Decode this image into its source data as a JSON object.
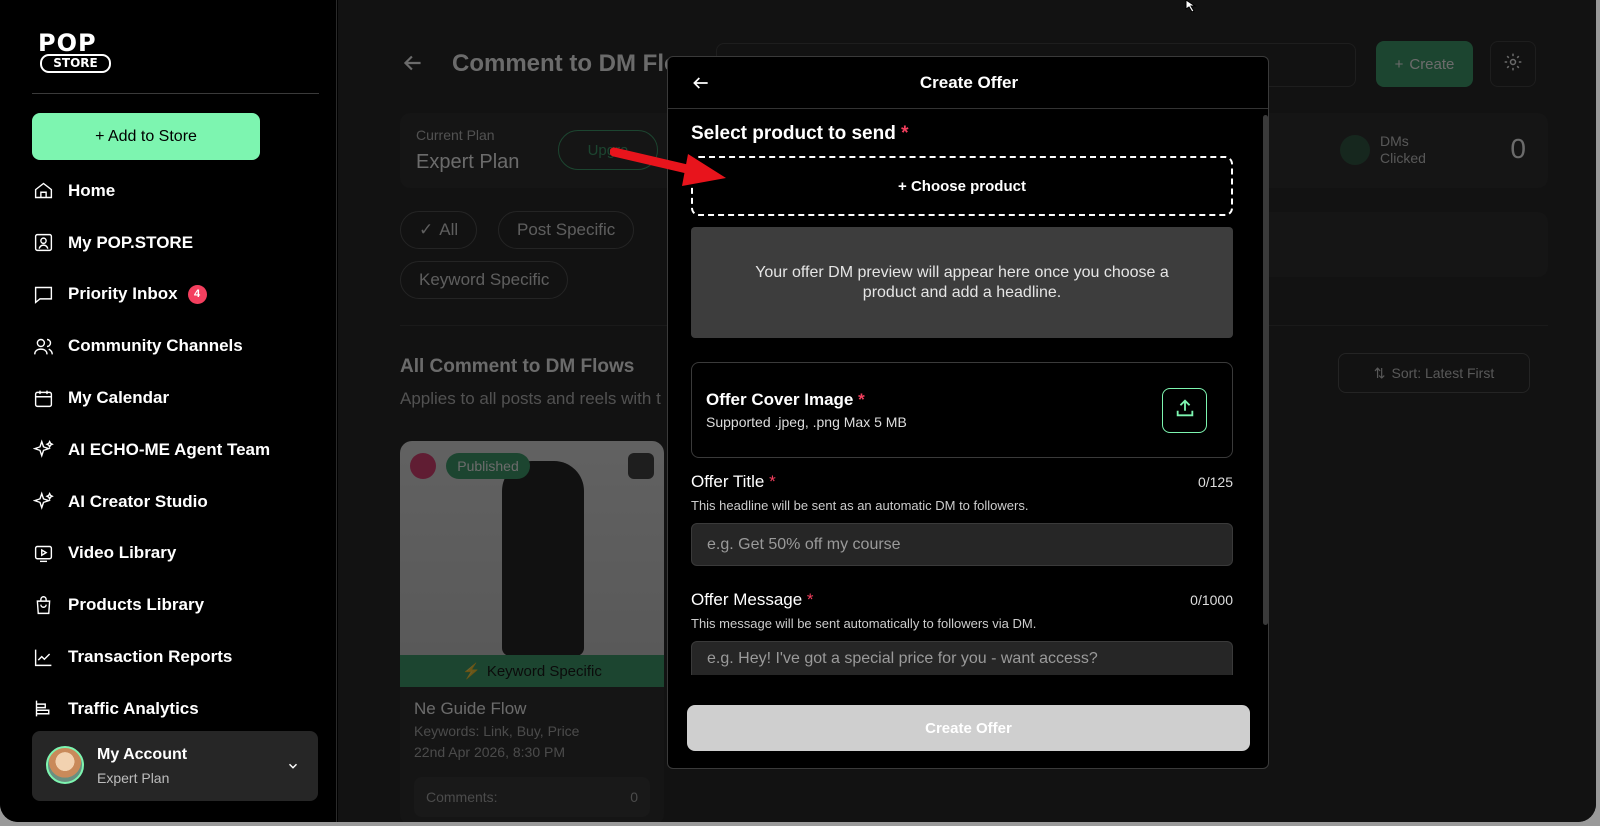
{
  "sidebar": {
    "logo_top": "POP",
    "logo_bottom": "STORE",
    "add_button": "+ Add to Store",
    "items": [
      {
        "label": "Home",
        "icon": "home-icon"
      },
      {
        "label": "My POP.STORE",
        "icon": "profile-icon"
      },
      {
        "label": "Priority Inbox",
        "icon": "chat-icon",
        "badge": "4"
      },
      {
        "label": "Community Channels",
        "icon": "users-icon"
      },
      {
        "label": "My Calendar",
        "icon": "calendar-icon"
      },
      {
        "label": "AI ECHO-ME Agent Team",
        "icon": "sparkle-icon"
      },
      {
        "label": "AI Creator Studio",
        "icon": "sparkle-icon"
      },
      {
        "label": "Video Library",
        "icon": "video-icon"
      },
      {
        "label": "Products Library",
        "icon": "bag-icon"
      },
      {
        "label": "Transaction Reports",
        "icon": "chart-icon"
      },
      {
        "label": "Traffic Analytics",
        "icon": "bars-icon"
      }
    ],
    "account": {
      "name": "My Account",
      "plan": "Expert Plan"
    }
  },
  "main": {
    "title": "Comment to DM Flo",
    "create_label": "Create",
    "plan_label": "Current Plan",
    "plan_value": "Expert Plan",
    "upgrade_label": "Upgra",
    "dm_label": "DMs Clicked",
    "dm_count": "0",
    "chips": [
      "All",
      "Post Specific",
      "Keyword Specific"
    ],
    "section_title": "All Comment to DM Flows",
    "section_sub": "Applies to all posts and reels with t",
    "sort_label": "Sort: Latest First",
    "card": {
      "status": "Published",
      "type": "Keyword Specific",
      "name": "Ne Guide Flow",
      "keywords": "Keywords: Link, Buy, Price",
      "date": "22nd Apr 2026, 8:30 PM",
      "comments_label": "Comments:",
      "comments_count": "0"
    }
  },
  "modal": {
    "title": "Create Offer",
    "select_label": "Select product to send",
    "choose_label": "+ Choose product",
    "preview_text": "Your offer DM preview will appear here once you choose a product and add a headline.",
    "cover_title": "Offer Cover Image",
    "cover_sub": "Supported .jpeg, .png Max 5 MB",
    "offer_title_label": "Offer Title",
    "offer_title_count": "0/125",
    "offer_title_help": "This headline will be sent as an automatic DM to followers.",
    "offer_title_placeholder": "e.g. Get 50% off my course",
    "offer_message_label": "Offer Message",
    "offer_message_count": "0/1000",
    "offer_message_help": "This message will be sent automatically to followers via DM.",
    "offer_message_placeholder": "e.g. Hey! I've got a special price for you - want access?",
    "submit_label": "Create Offer",
    "required_mark": "*"
  },
  "colors": {
    "accent": "#7df5b0",
    "required": "#f43f5e",
    "brand_green": "#2f9a62"
  }
}
